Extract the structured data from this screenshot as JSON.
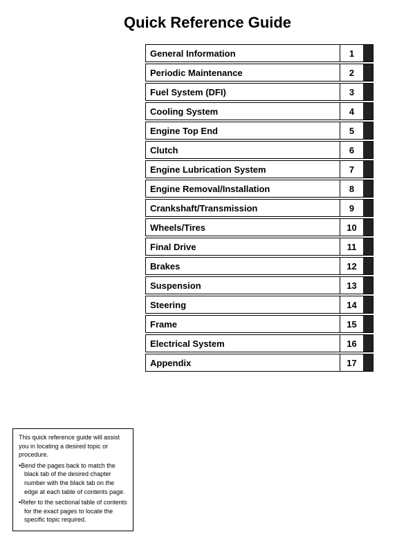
{
  "page": {
    "title": "Quick Reference Guide",
    "items": [
      {
        "label": "General Information",
        "number": "1"
      },
      {
        "label": "Periodic Maintenance",
        "number": "2"
      },
      {
        "label": "Fuel System (DFI)",
        "number": "3"
      },
      {
        "label": "Cooling System",
        "number": "4"
      },
      {
        "label": "Engine Top End",
        "number": "5"
      },
      {
        "label": "Clutch",
        "number": "6"
      },
      {
        "label": "Engine Lubrication System",
        "number": "7"
      },
      {
        "label": "Engine Removal/Installation",
        "number": "8"
      },
      {
        "label": "Crankshaft/Transmission",
        "number": "9"
      },
      {
        "label": "Wheels/Tires",
        "number": "10"
      },
      {
        "label": "Final Drive",
        "number": "11"
      },
      {
        "label": "Brakes",
        "number": "12"
      },
      {
        "label": "Suspension",
        "number": "13"
      },
      {
        "label": "Steering",
        "number": "14"
      },
      {
        "label": "Frame",
        "number": "15"
      },
      {
        "label": "Electrical System",
        "number": "16"
      },
      {
        "label": "Appendix",
        "number": "17"
      }
    ],
    "note": {
      "line1": "This quick reference guide will assist you in locating a desired topic or procedure.",
      "line2": "•Bend the pages back to match the black tab of the desired chapter number with the black tab on the edge at each table of contents page.",
      "line3": "•Refer to the sectional table of contents for the exact pages to locate the specific topic required."
    }
  }
}
